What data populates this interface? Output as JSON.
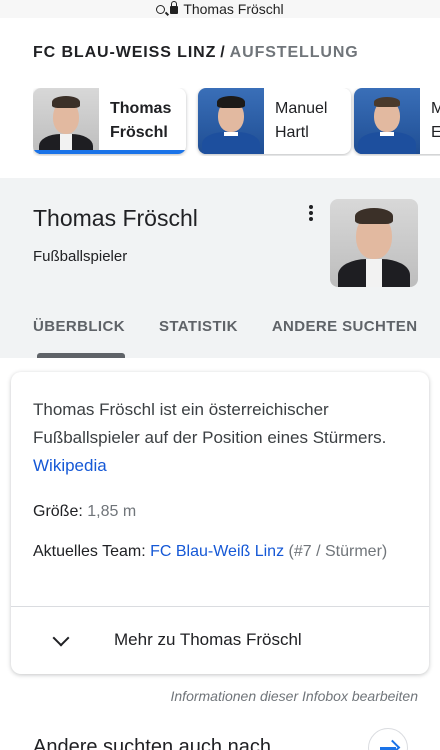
{
  "browser": {
    "url_text": "Thomas Fröschl"
  },
  "breadcrumb": {
    "team": "FC BLAU-WEISS LINZ",
    "separator": "/",
    "section": "AUFSTELLUNG"
  },
  "lineup": [
    {
      "first": "Thomas",
      "last": "Fröschl",
      "selected": true
    },
    {
      "first": "Manuel",
      "last": "Hartl",
      "selected": false
    },
    {
      "first": "M",
      "last": "E",
      "selected": false
    }
  ],
  "panel": {
    "title": "Thomas Fröschl",
    "subtitle": "Fußballspieler",
    "tabs": [
      "ÜBERBLICK",
      "STATISTIK",
      "ANDERE SUCHTEN"
    ]
  },
  "info": {
    "description": "Thomas Fröschl ist ein österreichischer Fußballspieler auf der Position eines Stürmers.",
    "source_link": "Wikipedia",
    "facts": {
      "height_label": "Größe:",
      "height_value": "1,85 m",
      "team_label": "Aktuelles Team:",
      "team_link": "FC Blau-Weiß Linz",
      "team_suffix": "(#7 / Stürmer)"
    },
    "more_label": "Mehr zu Thomas Fröschl"
  },
  "edit_note": "Informationen dieser Infobox bearbeiten",
  "related": {
    "label": "Andere suchten auch nach"
  },
  "colors": {
    "accent": "#1a73e8",
    "link": "#1558d6",
    "panel_bg": "#f1f3f4"
  }
}
